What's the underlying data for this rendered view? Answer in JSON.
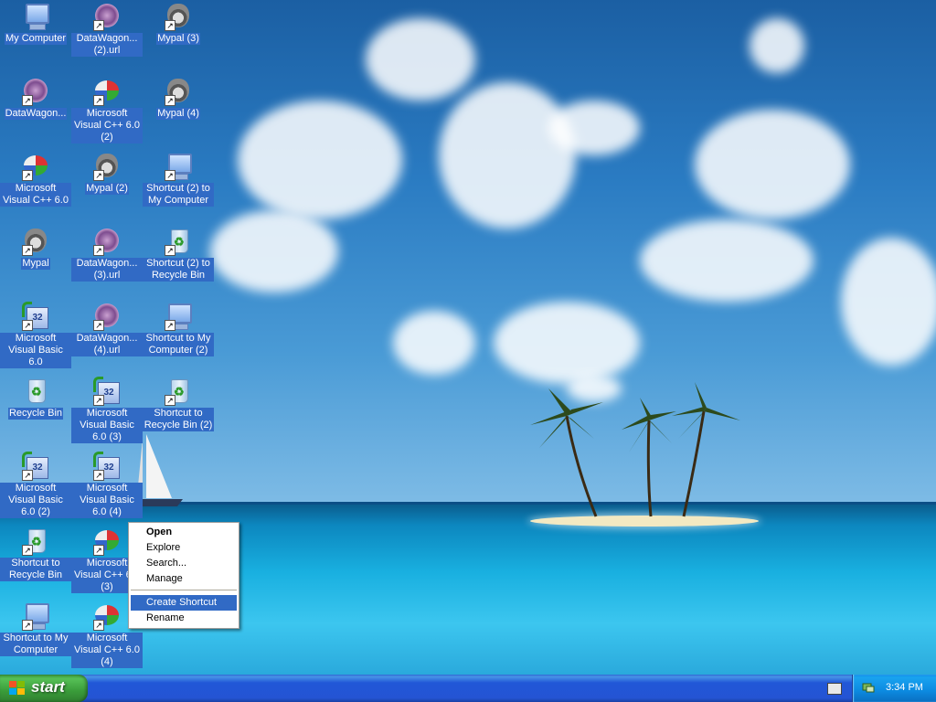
{
  "desktop": {
    "icons": [
      {
        "label": "My Computer",
        "icon": "my-computer-icon",
        "shortcut": false
      },
      {
        "label": "DataWagon...",
        "icon": "datawagon-url-icon",
        "shortcut": true
      },
      {
        "label": "Microsoft Visual C++ 6.0",
        "icon": "visual-cpp-icon",
        "shortcut": true
      },
      {
        "label": "Mypal",
        "icon": "mypal-icon",
        "shortcut": true
      },
      {
        "label": "Microsoft Visual Basic 6.0",
        "icon": "visual-basic-icon",
        "shortcut": true
      },
      {
        "label": "Recycle Bin",
        "icon": "recycle-bin-icon",
        "shortcut": false
      },
      {
        "label": "Microsoft Visual Basic 6.0 (2)",
        "icon": "visual-basic-icon",
        "shortcut": true
      },
      {
        "label": "Shortcut to Recycle Bin",
        "icon": "recycle-bin-icon",
        "shortcut": true
      },
      {
        "label": "Shortcut to My Computer",
        "icon": "my-computer-icon",
        "shortcut": true
      },
      {
        "label": "DataWagon... (2).url",
        "icon": "datawagon-url-icon",
        "shortcut": true
      },
      {
        "label": "Microsoft Visual C++ 6.0 (2)",
        "icon": "visual-cpp-icon",
        "shortcut": true
      },
      {
        "label": "Mypal (2)",
        "icon": "mypal-icon",
        "shortcut": true
      },
      {
        "label": "DataWagon... (3).url",
        "icon": "datawagon-url-icon",
        "shortcut": true
      },
      {
        "label": "DataWagon... (4).url",
        "icon": "datawagon-url-icon",
        "shortcut": true
      },
      {
        "label": "Microsoft Visual Basic 6.0 (3)",
        "icon": "visual-basic-icon",
        "shortcut": true
      },
      {
        "label": "Microsoft Visual Basic 6.0 (4)",
        "icon": "visual-basic-icon",
        "shortcut": true
      },
      {
        "label": "Microsoft Visual C++ 6.0 (3)",
        "icon": "visual-cpp-icon",
        "shortcut": true
      },
      {
        "label": "Microsoft Visual C++ 6.0 (4)",
        "icon": "visual-cpp-icon",
        "shortcut": true
      },
      {
        "label": "Mypal (3)",
        "icon": "mypal-icon",
        "shortcut": true
      },
      {
        "label": "Mypal (4)",
        "icon": "mypal-icon",
        "shortcut": true
      },
      {
        "label": "Shortcut (2) to My Computer",
        "icon": "my-computer-icon",
        "shortcut": true
      },
      {
        "label": "Shortcut (2) to Recycle Bin",
        "icon": "recycle-bin-icon",
        "shortcut": true
      },
      {
        "label": "Shortcut to My Computer (2)",
        "icon": "my-computer-icon",
        "shortcut": true
      },
      {
        "label": "Shortcut to Recycle Bin (2)",
        "icon": "recycle-bin-icon",
        "shortcut": true
      }
    ]
  },
  "context_menu": {
    "items": [
      {
        "label": "Open",
        "bold": true
      },
      {
        "label": "Explore"
      },
      {
        "label": "Search..."
      },
      {
        "label": "Manage"
      },
      {
        "label": "Create Shortcut",
        "highlighted": true
      },
      {
        "label": "Rename"
      }
    ]
  },
  "taskbar": {
    "start_label": "start",
    "clock": "3:34 PM"
  },
  "colors": {
    "selection": "#316ac5",
    "taskbar": "#2454d4",
    "start_button": "#3a9c3a",
    "tray": "#0c8ae0"
  }
}
